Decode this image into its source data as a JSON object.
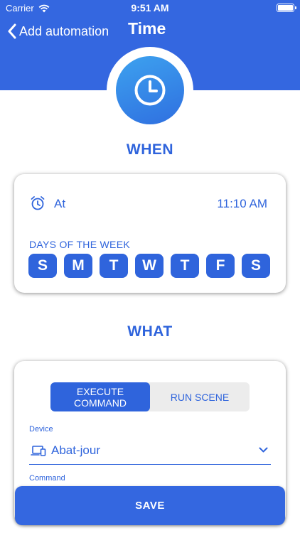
{
  "status_bar": {
    "carrier": "Carrier",
    "time": "9:51 AM"
  },
  "nav": {
    "back_label": "Add automation",
    "title": "Time"
  },
  "header_icon": "clock-icon",
  "when": {
    "title": "WHEN",
    "at_label": "At",
    "at_time": "11:10 AM",
    "days_label": "DAYS OF THE WEEK",
    "days": [
      "S",
      "M",
      "T",
      "W",
      "T",
      "F",
      "S"
    ]
  },
  "what": {
    "title": "WHAT",
    "segments": [
      "EXECUTE\nCOMMAND",
      "RUN SCENE"
    ],
    "selected_segment": "EXECUTE COMMAND",
    "device_label": "Device",
    "device_value": "Abat-jour",
    "command_label": "Command"
  },
  "save_label": "SAVE",
  "colors": {
    "primary": "#3467e0",
    "text": "#2f64dc",
    "segment_bg": "#ececec"
  }
}
